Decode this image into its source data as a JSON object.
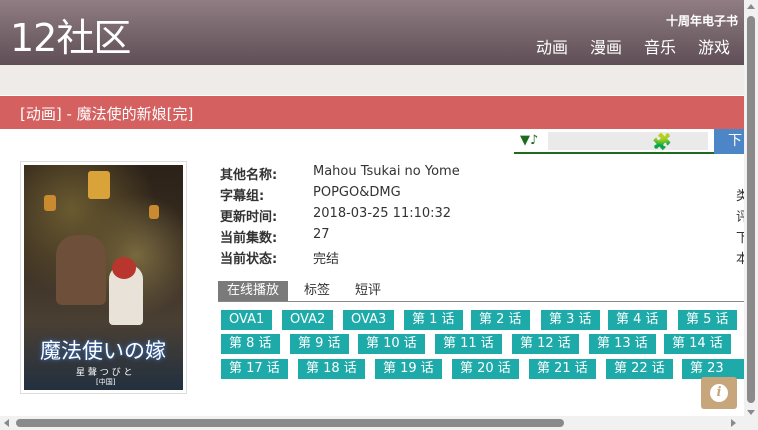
{
  "site": {
    "logo": "12社区",
    "promo": "十周年电子书"
  },
  "nav": [
    "动画",
    "漫画",
    "音乐",
    "游戏"
  ],
  "page": {
    "title": "[动画] - 魔法使的新娘[完]"
  },
  "player": {
    "note_icon": "music-note-icon",
    "plugin_icon": "puzzle-icon"
  },
  "download_button": "下",
  "poster": {
    "title": "魔法使いの嫁",
    "subtitle": "星 聲 つ び と",
    "caption": "[中国]"
  },
  "details": [
    {
      "label": "其他名称:",
      "value": "Mahou Tsukai no Yome"
    },
    {
      "label": "字幕组:",
      "value": "POPGO&DMG"
    },
    {
      "label": "更新时间:",
      "value": "2018-03-25 11:10:32"
    },
    {
      "label": "当前集数:",
      "value": "27"
    },
    {
      "label": "当前状态:",
      "value": "完结"
    }
  ],
  "right_edge_labels": [
    "类",
    "评",
    "下",
    "本"
  ],
  "tabs": [
    "在线播放",
    "标签",
    "短评"
  ],
  "episodes": [
    [
      "OVA1",
      "OVA2",
      "OVA3",
      "第 1 话",
      "第 2 话",
      "第 3 话",
      "第 4 话",
      "第 5 话"
    ],
    [
      "第 8 话",
      "第 9 话",
      "第 10 话",
      "第 11 话",
      "第 12 话",
      "第 13 话",
      "第 14 话"
    ],
    [
      "第 17 话",
      "第 18 话",
      "第 19 话",
      "第 20 话",
      "第 21 话",
      "第 22 话",
      "第 23 话"
    ]
  ],
  "info_button": "i",
  "colors": {
    "header": "#7a6870",
    "title_bar": "#d46060",
    "episode_button": "#1faaaa",
    "player_line": "#1d6b1d",
    "download_button": "#4d86c6"
  }
}
